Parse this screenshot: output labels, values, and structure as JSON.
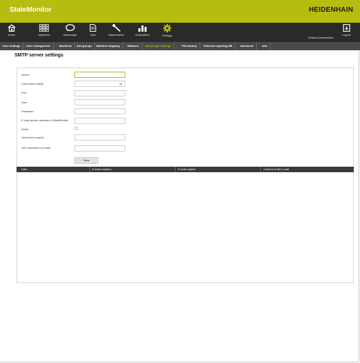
{
  "app": {
    "title": "StateMonitor",
    "brand": "HEIDENHAIN"
  },
  "nav": {
    "items": [
      {
        "label": "Home",
        "icon": "home-icon"
      },
      {
        "label": "Machines",
        "icon": "machines-grid-icon"
      },
      {
        "label": "Messenger",
        "icon": "messenger-bubble-icon"
      },
      {
        "label": "Jobs",
        "icon": "jobs-document-icon"
      },
      {
        "label": "Maintenance",
        "icon": "wrench-icon"
      },
      {
        "label": "Evaluations",
        "icon": "bar-chart-icon"
      },
      {
        "label": "Settings",
        "icon": "gear-icon"
      }
    ],
    "user": "Default Administrator",
    "logout": "Logout"
  },
  "tabs": [
    {
      "label": "User settings"
    },
    {
      "label": "User management"
    },
    {
      "label": "Machines"
    },
    {
      "label": "Add groups"
    },
    {
      "label": "Machine mapping"
    },
    {
      "label": "Statuses"
    },
    {
      "label": "Messenger settings"
    },
    {
      "label": "File backup"
    },
    {
      "label": "External reporting DB"
    },
    {
      "label": "Advanced"
    },
    {
      "label": "Info"
    }
  ],
  "page": {
    "title": "SMTP server settings"
  },
  "form": {
    "server_label": "Server",
    "connection_safety_label": "Connection safety",
    "port_label": "Port",
    "user_label": "User",
    "password_label": "Password",
    "sender_label": "E-mail sender address of StateMonitor",
    "active_label": "Active",
    "send_test_label": "Send test e-mail to",
    "url_label": "URL (inserted in e-mail)",
    "save_label": "Save",
    "required_marker": "*"
  },
  "table": {
    "columns": [
      "Date",
      "E-mail recipient",
      "E-mail subject",
      "Content of the e-mail"
    ]
  },
  "colors": {
    "accent": "#b5bd10",
    "nav_bg": "#2a2a2a",
    "tab_bg": "#4a4a4a"
  }
}
